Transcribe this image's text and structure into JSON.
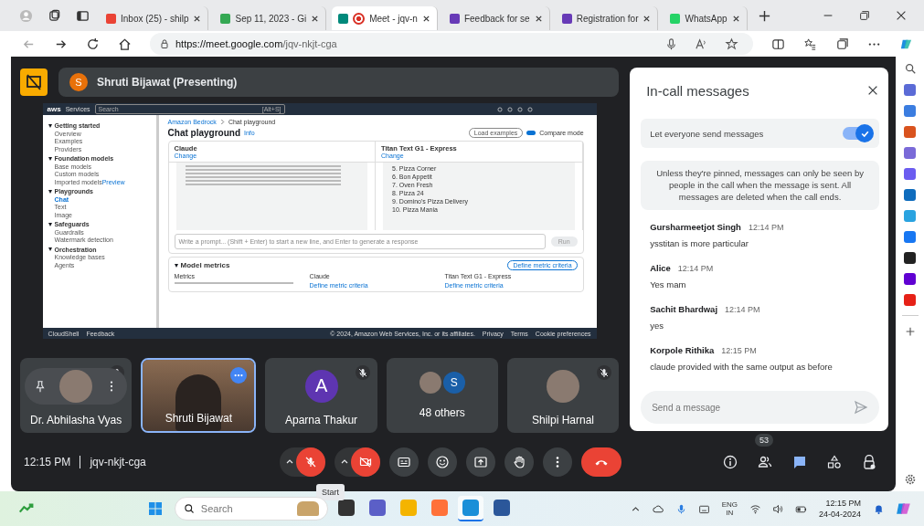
{
  "tabs": [
    {
      "kind": "gmail",
      "label": "Inbox (25) - shilp",
      "selected": false,
      "recording": false
    },
    {
      "kind": "drive",
      "label": "Sep 11, 2023 - Gi",
      "selected": false,
      "recording": false
    },
    {
      "kind": "meet",
      "label": "Meet - jqv-n",
      "selected": true,
      "recording": true
    },
    {
      "kind": "forms",
      "label": "Feedback for se",
      "selected": false,
      "recording": false
    },
    {
      "kind": "forms",
      "label": "Registration for",
      "selected": false,
      "recording": false
    },
    {
      "kind": "whatsapp",
      "label": "WhatsApp",
      "selected": false,
      "recording": false
    }
  ],
  "address_bar": {
    "url_host": "https://meet.google.com",
    "url_path": "/jqv-nkjt-cga"
  },
  "presenter": {
    "initial": "S",
    "label": "Shruti Bijawat (Presenting)"
  },
  "shared_screen": {
    "top_bar": {
      "logo": "aws",
      "services": "Services",
      "search_placeholder": "Search",
      "shortcut": "[Alt+S]"
    },
    "sidebar": [
      {
        "heading": "Getting started",
        "items": [
          {
            "label": "Overview",
            "selected": false
          },
          {
            "label": "Examples",
            "selected": false
          },
          {
            "label": "Providers",
            "selected": false
          }
        ]
      },
      {
        "heading": "Foundation models",
        "items": [
          {
            "label": "Base models",
            "selected": false
          },
          {
            "label": "Custom models",
            "selected": false
          },
          {
            "label": "Imported models",
            "selected": false,
            "badge": "Preview"
          }
        ]
      },
      {
        "heading": "Playgrounds",
        "items": [
          {
            "label": "Chat",
            "selected": true
          },
          {
            "label": "Text",
            "selected": false
          },
          {
            "label": "Image",
            "selected": false
          }
        ]
      },
      {
        "heading": "Safeguards",
        "items": [
          {
            "label": "Guardrails",
            "selected": false
          },
          {
            "label": "Watermark detection",
            "selected": false
          }
        ]
      },
      {
        "heading": "Orchestration",
        "items": [
          {
            "label": "Knowledge bases",
            "selected": false
          },
          {
            "label": "Agents",
            "selected": false
          }
        ]
      }
    ],
    "breadcrumb": [
      "Amazon Bedrock",
      "Chat playground"
    ],
    "title": "Chat playground",
    "info": "Info",
    "load_examples": "Load examples",
    "compare_mode": {
      "label": "Compare mode",
      "on": true
    },
    "models": [
      {
        "name": "Claude",
        "change": "Change"
      },
      {
        "name": "Titan Text G1 - Express",
        "change": "Change",
        "lines": [
          "5. Pizza Corner",
          "6. Bon Appetit",
          "7. Oven Fresh",
          "8. Pizza 24",
          "9. Domino's Pizza Delivery",
          "10. Pizza Mania"
        ]
      }
    ],
    "prompt_placeholder": "Write a prompt... (Shift + Enter) to start a new line, and Enter to generate a response",
    "run": "Run",
    "metrics": {
      "title": "Model metrics",
      "define": "Define metric criteria",
      "columns": [
        "Metrics",
        "Claude",
        "Titan Text G1 - Express"
      ],
      "cells": [
        "Define metric criteria",
        "Define metric criteria"
      ]
    },
    "footer": {
      "left": [
        "CloudShell",
        "Feedback"
      ],
      "copyright": "© 2024, Amazon Web Services, Inc. or its affiliates.",
      "links": [
        "Privacy",
        "Terms",
        "Cookie preferences"
      ]
    }
  },
  "chat": {
    "title": "In-call messages",
    "toggle": {
      "label": "Let everyone send messages",
      "on": true
    },
    "notice": "Unless they're pinned, messages can only be seen by people in the call when the message is sent. All messages are deleted when the call ends.",
    "messages": [
      {
        "sender": "Gursharmeetjot Singh",
        "time": "12:14 PM",
        "text": "ysstitan is more particular"
      },
      {
        "sender": "Alice",
        "time": "12:14 PM",
        "text": "Yes mam"
      },
      {
        "sender": "Sachit Bhardwaj",
        "time": "12:14 PM",
        "text": "yes"
      },
      {
        "sender": "Korpole Rithika",
        "time": "12:15 PM",
        "text": "claude provided with the same output as before"
      }
    ],
    "input": {
      "placeholder": "Send a message"
    }
  },
  "participants": [
    {
      "kind": "photo",
      "name": "Dr. Abhilasha Vyas",
      "muted": true,
      "hovered": true
    },
    {
      "kind": "video",
      "name": "Shruti Bijawat",
      "muted": false,
      "hovered": false
    },
    {
      "kind": "initial",
      "name": "Aparna Thakur",
      "initial": "A",
      "muted": true,
      "hovered": false
    },
    {
      "kind": "group",
      "name": "48 others",
      "initial": "S",
      "muted": false,
      "hovered": false
    },
    {
      "kind": "photo",
      "name": "Shilpi Harnal",
      "muted": true,
      "hovered": false
    }
  ],
  "bottom_bar": {
    "time": "12:15 PM",
    "meeting_code": "jqv-nkjt-cga",
    "tooltip": "Start",
    "controls": [
      {
        "kind": "mic",
        "off": true
      },
      {
        "kind": "camera",
        "off": true
      },
      {
        "kind": "captions",
        "off": false
      },
      {
        "kind": "emoji",
        "off": false
      },
      {
        "kind": "present",
        "off": false
      },
      {
        "kind": "hand",
        "off": false
      },
      {
        "kind": "more",
        "off": false
      },
      {
        "kind": "leave"
      }
    ],
    "people_count": "53",
    "side_controls": [
      {
        "kind": "info",
        "selected": false
      },
      {
        "kind": "people",
        "selected": false
      },
      {
        "kind": "chat",
        "selected": true
      },
      {
        "kind": "activities",
        "selected": false
      },
      {
        "kind": "host",
        "selected": false
      }
    ]
  },
  "taskbar": {
    "search_placeholder": "Search",
    "apps": [
      {
        "kind": "taskview",
        "selected": false
      },
      {
        "kind": "teams",
        "selected": false
      },
      {
        "kind": "explorer",
        "selected": false
      },
      {
        "kind": "firefox",
        "selected": false
      },
      {
        "kind": "edge",
        "selected": true
      },
      {
        "kind": "word",
        "selected": false
      }
    ],
    "language": "ENG",
    "region": "IN",
    "time": "12:15 PM",
    "date": "24-04-2024"
  }
}
